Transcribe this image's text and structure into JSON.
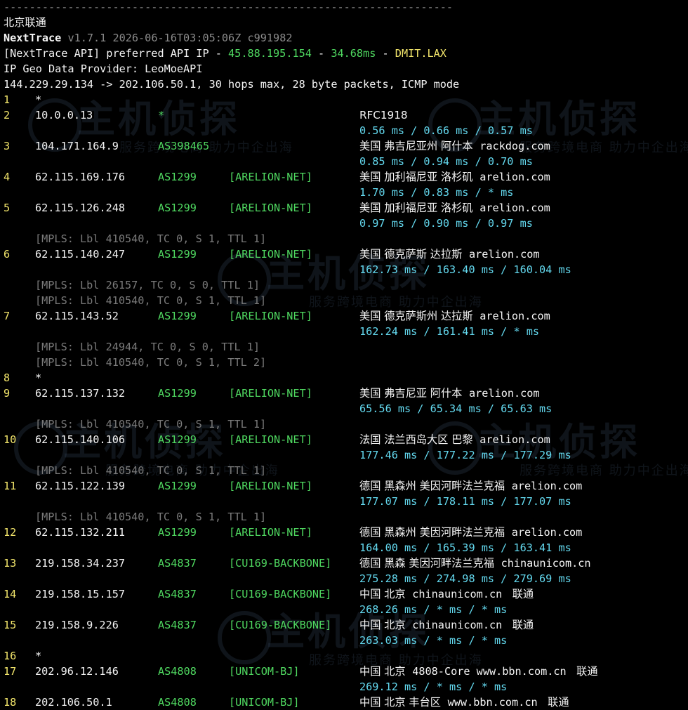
{
  "separator": "----------------------------------------------------------------------",
  "title": "北京联通",
  "header": {
    "app_name": "NextTrace",
    "version_info": "v1.7.1 2026-06-16T03:05:06Z c991982",
    "api_prefix": "[NextTrace API] preferred API IP - ",
    "api_ip": "45.88.195.154",
    "dash": " - ",
    "api_latency": "34.68ms",
    "api_node": "DMIT.LAX",
    "geo_provider": "IP Geo Data Provider: LeoMoeAPI",
    "trace_line": "144.229.29.134 -> 202.106.50.1, 30 hops max, 28 byte packets, ICMP mode"
  },
  "hops": [
    {
      "hop": "1",
      "star": "*"
    },
    {
      "hop": "2",
      "ip": "10.0.0.13",
      "asn": "*",
      "tag": "",
      "geo": "RFC1918",
      "domain": "",
      "isp": "",
      "rtt": "0.56 ms / 0.66 ms / 0.57 ms"
    },
    {
      "hop": "3",
      "ip": "104.171.164.9",
      "asn": "AS398465",
      "tag": "",
      "geo": "美国 弗吉尼亚州 阿什本",
      "domain": "rackdog.com",
      "isp": "",
      "rtt": "0.85 ms / 0.94 ms / 0.70 ms"
    },
    {
      "hop": "4",
      "ip": "62.115.169.176",
      "asn": "AS1299",
      "tag": "[ARELION-NET]",
      "geo": "美国 加利福尼亚 洛杉矶",
      "domain": "arelion.com",
      "isp": "",
      "rtt": "1.70 ms / 0.83 ms / * ms"
    },
    {
      "hop": "5",
      "ip": "62.115.126.248",
      "asn": "AS1299",
      "tag": "[ARELION-NET]",
      "geo": "美国 加利福尼亚 洛杉矶",
      "domain": "arelion.com",
      "isp": "",
      "rtt": "0.97 ms / 0.90 ms / 0.97 ms",
      "mpls": [
        "[MPLS: Lbl 410540, TC 0, S 1, TTL 1]"
      ]
    },
    {
      "hop": "6",
      "ip": "62.115.140.247",
      "asn": "AS1299",
      "tag": "[ARELION-NET]",
      "geo": "美国 德克萨斯 达拉斯",
      "domain": "arelion.com",
      "isp": "",
      "rtt": "162.73 ms / 163.40 ms / 160.04 ms",
      "mpls": [
        "[MPLS: Lbl 26157, TC 0, S 0, TTL 1]",
        "[MPLS: Lbl 410540, TC 0, S 1, TTL 1]"
      ]
    },
    {
      "hop": "7",
      "ip": "62.115.143.52",
      "asn": "AS1299",
      "tag": "[ARELION-NET]",
      "geo": "美国 德克萨斯州 达拉斯",
      "domain": "arelion.com",
      "isp": "",
      "rtt": "162.24 ms / 161.41 ms / * ms",
      "mpls": [
        "[MPLS: Lbl 24944, TC 0, S 0, TTL 1]",
        "[MPLS: Lbl 410540, TC 0, S 1, TTL 2]"
      ]
    },
    {
      "hop": "8",
      "star": "*"
    },
    {
      "hop": "9",
      "ip": "62.115.137.132",
      "asn": "AS1299",
      "tag": "[ARELION-NET]",
      "geo": "美国 弗吉尼亚 阿什本",
      "domain": "arelion.com",
      "isp": "",
      "rtt": "65.56 ms / 65.34 ms / 65.63 ms",
      "mpls": [
        "[MPLS: Lbl 410540, TC 0, S 1, TTL 1]"
      ]
    },
    {
      "hop": "10",
      "ip": "62.115.140.106",
      "asn": "AS1299",
      "tag": "[ARELION-NET]",
      "geo": "法国 法兰西岛大区 巴黎",
      "domain": "arelion.com",
      "isp": "",
      "rtt": "177.46 ms / 177.22 ms / 177.29 ms",
      "mpls": [
        "[MPLS: Lbl 410540, TC 0, S 1, TTL 1]"
      ]
    },
    {
      "hop": "11",
      "ip": "62.115.122.139",
      "asn": "AS1299",
      "tag": "[ARELION-NET]",
      "geo": "德国 黑森州 美因河畔法兰克福",
      "domain": "arelion.com",
      "isp": "",
      "rtt": "177.07 ms / 178.11 ms / 177.07 ms",
      "mpls": [
        "[MPLS: Lbl 410540, TC 0, S 1, TTL 1]"
      ]
    },
    {
      "hop": "12",
      "ip": "62.115.132.211",
      "asn": "AS1299",
      "tag": "[ARELION-NET]",
      "geo": "德国 黑森州 美因河畔法兰克福",
      "domain": "arelion.com",
      "isp": "",
      "rtt": "164.00 ms / 165.39 ms / 163.41 ms"
    },
    {
      "hop": "13",
      "ip": "219.158.34.237",
      "asn": "AS4837",
      "tag": "[CU169-BACKBONE]",
      "geo": "德国 黑森 美因河畔法兰克福",
      "domain": "chinaunicom.cn",
      "isp": "",
      "rtt": "275.28 ms / 274.98 ms / 279.69 ms"
    },
    {
      "hop": "14",
      "ip": "219.158.15.157",
      "asn": "AS4837",
      "tag": "[CU169-BACKBONE]",
      "geo": "中国 北京",
      "domain": "chinaunicom.cn",
      "isp": "联通",
      "rtt": "268.26 ms / * ms / * ms"
    },
    {
      "hop": "15",
      "ip": "219.158.9.226",
      "asn": "AS4837",
      "tag": "[CU169-BACKBONE]",
      "geo": "中国 北京",
      "domain": "chinaunicom.cn",
      "isp": "联通",
      "rtt": "263.03 ms / * ms / * ms"
    },
    {
      "hop": "16",
      "star": "*"
    },
    {
      "hop": "17",
      "ip": "202.96.12.146",
      "asn": "AS4808",
      "tag": "[UNICOM-BJ]",
      "geo": "中国 北京",
      "domain": "4808-Core www.bbn.com.cn",
      "isp": "联通",
      "rtt": "269.12 ms / * ms / * ms"
    },
    {
      "hop": "18",
      "ip": "202.106.50.1",
      "asn": "AS4808",
      "tag": "[UNICOM-BJ]",
      "geo": "中国 北京 丰台区",
      "domain": "www.bbn.com.cn",
      "isp": "联通",
      "rtt": ""
    }
  ],
  "watermark": {
    "brand": "主机侦探",
    "slogan": "服务跨境电商 助力中企出海"
  },
  "colors": {
    "background": "#000000",
    "hop_number": "#f2e56b",
    "asn": "#4fd860",
    "rtt": "#63d8ee",
    "mpls": "#7a7a7a"
  }
}
